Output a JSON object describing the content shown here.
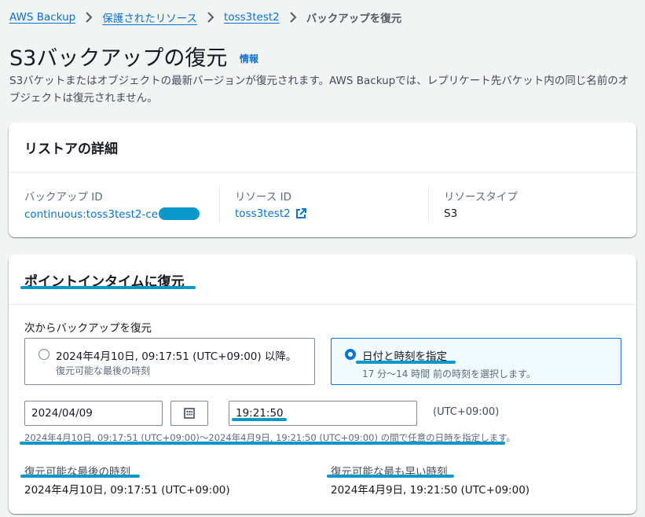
{
  "breadcrumb": {
    "items": [
      "AWS Backup",
      "保護されたリソース",
      "toss3test2"
    ],
    "current": "バックアップを復元"
  },
  "page": {
    "title": "S3バックアップの復元",
    "info_link": "情報",
    "description": "S3バケットまたはオブジェクトの最新バージョンが復元されます。AWS Backupでは、レプリケート先バケット内の同じ名前のオブジェクトは復元されません。"
  },
  "restore_details": {
    "heading": "リストアの詳細",
    "backup_id_label": "バックアップ ID",
    "backup_id_value": "continuous:toss3test2-ce",
    "resource_id_label": "リソース ID",
    "resource_id_value": "toss3test2",
    "resource_type_label": "リソースタイプ",
    "resource_type_value": "S3"
  },
  "pitr": {
    "heading": "ポイントインタイムに復元",
    "restore_from_label": "次からバックアップを復元",
    "option_latest": {
      "label": "2024年4月10日, 09:17:51 (UTC+09:00) 以降。",
      "sub": "復元可能な最後の時刻"
    },
    "option_specify": {
      "label": "日付と時刻を指定",
      "sub": "17 分〜14 時間 前の時刻を選択します。"
    },
    "date_value": "2024/04/09",
    "time_value": "19:21:50",
    "timezone": "(UTC+09:00)",
    "range_hint": "2024年4月10日, 09:17:51 (UTC+09:00)〜2024年4月9日, 19:21:50 (UTC+09:00) の間で任意の日時を指定します。",
    "latest_label": "復元可能な最後の時刻",
    "latest_value": "2024年4月10日, 09:17:51 (UTC+09:00)",
    "earliest_label": "復元可能な最も早い時刻",
    "earliest_value": "2024年4月9日, 19:21:50 (UTC+09:00)"
  },
  "colors": {
    "link": "#0972d3",
    "highlight": "#0a97c9",
    "selected_tile_bg": "#f1faff"
  },
  "icons": [
    "chevron-right-icon",
    "external-link-icon",
    "calendar-icon"
  ]
}
